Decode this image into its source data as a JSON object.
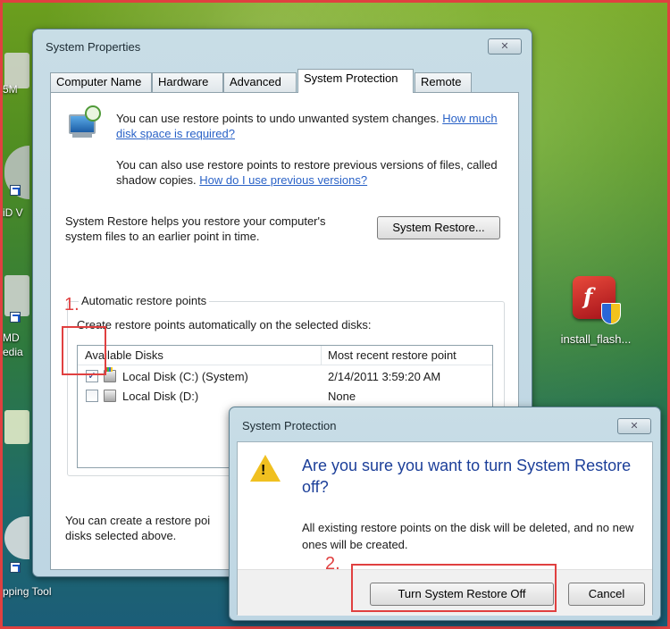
{
  "desktop": {
    "left_fragments": [
      "5M",
      "iD V",
      "MD",
      "edia",
      "pping Tool"
    ],
    "flash_icon_label": "install_flash..."
  },
  "window": {
    "title": "System Properties",
    "close_glyph": "✕",
    "tabs": [
      {
        "label": "Computer Name"
      },
      {
        "label": "Hardware"
      },
      {
        "label": "Advanced"
      },
      {
        "label": "System Protection"
      },
      {
        "label": "Remote"
      }
    ],
    "active_tab": "System Protection",
    "intro1": "You can use restore points to undo unwanted system changes.",
    "intro1_link": "How much disk space is required?",
    "intro2": "You can also use restore points to restore previous versions of files, called shadow copies.",
    "intro2_link": "How do I use previous versions?",
    "restore_text": "System Restore helps you restore your computer's system files to an earlier point in time.",
    "restore_button": "System Restore...",
    "group_title": "Automatic restore points",
    "group_desc": "Create restore points automatically on the selected disks:",
    "columns": [
      "Available Disks",
      "Most recent restore point"
    ],
    "disks": [
      {
        "name": "Local Disk (C:) (System)",
        "checked": true,
        "restore_point": "2/14/2011 3:59:20 AM"
      },
      {
        "name": "Local Disk (D:)",
        "checked": false,
        "restore_point": "None"
      }
    ],
    "check_glyph": "✓",
    "bottom_text": "You can create a restore poi disks selected above."
  },
  "annotations": {
    "step1": "1.",
    "step2": "2.",
    "color": "#e04040"
  },
  "dialog": {
    "title": "System Protection",
    "close_glyph": "✕",
    "warning_mark": "!",
    "heading": "Are you sure you want to turn System Restore off?",
    "message": "All existing restore points on the disk will be deleted, and no new ones will be created.",
    "confirm_button": "Turn System Restore Off",
    "cancel_button": "Cancel"
  },
  "colors": {
    "link": "#2a62c7",
    "dialog_heading": "#1c3f99",
    "warning": "#f0c020"
  }
}
